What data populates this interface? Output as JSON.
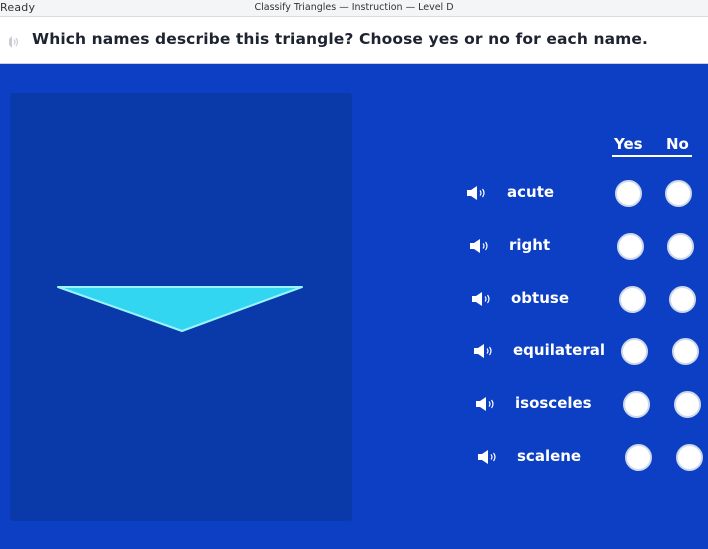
{
  "window": {
    "app_name": "Ready",
    "title": "Classify Triangles — Instruction — Level D"
  },
  "question": {
    "text": "Which names describe this triangle? Choose yes or no for each name.",
    "speaker_icon": "speaker-icon"
  },
  "figure": {
    "shape": "obtuse isosceles triangle",
    "fill_color": "#33d6f0",
    "stroke_color": "#9af3ff"
  },
  "columns": {
    "yes": "Yes",
    "no": "No"
  },
  "rows": [
    {
      "label": "acute",
      "yes_selected": false,
      "no_selected": false
    },
    {
      "label": "right",
      "yes_selected": false,
      "no_selected": false
    },
    {
      "label": "obtuse",
      "yes_selected": false,
      "no_selected": false
    },
    {
      "label": "equilateral",
      "yes_selected": false,
      "no_selected": false
    },
    {
      "label": "isosceles",
      "yes_selected": false,
      "no_selected": false
    },
    {
      "label": "scalene",
      "yes_selected": false,
      "no_selected": false
    }
  ],
  "colors": {
    "background": "#0d3fc4",
    "panel": "#0a3aa9",
    "text": "#ffffff"
  }
}
